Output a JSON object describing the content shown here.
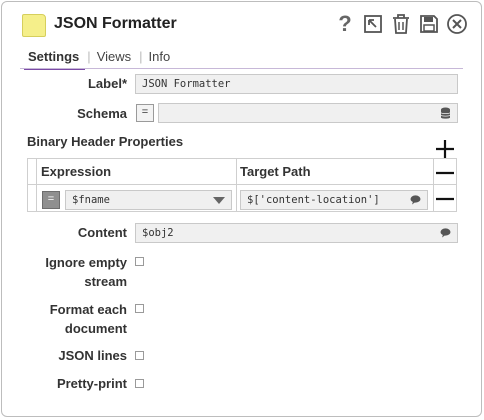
{
  "title": "JSON Formatter",
  "tabs": [
    {
      "label": "Settings"
    },
    {
      "label": "Views"
    },
    {
      "label": "Info"
    }
  ],
  "fields": {
    "label": {
      "label": "Label*",
      "value": "JSON Formatter"
    },
    "schema": {
      "label": "Schema",
      "value": ""
    },
    "content": {
      "label": "Content",
      "value": "$obj2"
    }
  },
  "binary_header": {
    "title": "Binary Header Properties",
    "columns": [
      "Expression",
      "Target Path"
    ],
    "rows": [
      {
        "expression": "$fname",
        "target_path": "$['content-location']"
      }
    ]
  },
  "checkboxes": [
    {
      "label_line1": "Ignore empty",
      "label_line2": "stream",
      "checked": false
    },
    {
      "label_line1": "Format each",
      "label_line2": "document",
      "checked": false
    },
    {
      "label_line1": "JSON lines",
      "label_line2": "",
      "checked": false
    },
    {
      "label_line1": "Pretty-print",
      "label_line2": "",
      "checked": false
    }
  ],
  "mode_button_glyph": "=",
  "help_glyph": "?",
  "icons": [
    "help-icon",
    "export-icon",
    "delete-icon",
    "save-icon",
    "close-icon",
    "database-icon",
    "comment-icon",
    "plus-icon",
    "minus-icon",
    "dropdown-arrow-icon"
  ],
  "colors": {
    "accent": "#7b4aa6",
    "title_icon": "#f5ef8a",
    "field_bg": "#f0f0f0"
  }
}
